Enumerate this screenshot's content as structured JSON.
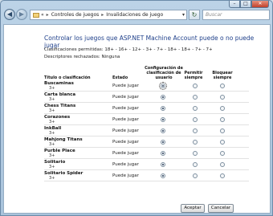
{
  "window": {
    "controls": {
      "minimize": "–",
      "maximize": "□",
      "close": "✕"
    }
  },
  "toolbar": {
    "back_glyph": "◀",
    "forward_glyph": "▶",
    "breadcrumb": [
      "Controles de juegos",
      "Invalidaciones de juego"
    ],
    "breadcrumb_prefix": "«",
    "separator": "▸",
    "refresh_glyph": "↻",
    "search_placeholder": "Buscar"
  },
  "main": {
    "title": "Controlar los juegos que ASP.NET Machine Account puede o no puede jugar",
    "allowed_ratings_label": "Clasificaciones permitidas:",
    "allowed_ratings_value": "18+ - 16+ - 12+ - 3+ - 7+ - 18+ - 18+ - 7+ - 7+",
    "blocked_descriptors_label": "Descriptores rechazados:",
    "blocked_descriptors_value": "Ninguna"
  },
  "table": {
    "headers": {
      "title": "Título o clasificación",
      "state": "Estado",
      "config": "Configuración de clasificación de usuario",
      "allow": "Permitir siempre",
      "block": "Bloquear siempre"
    },
    "rows": [
      {
        "name": "Buscaminas",
        "rating": "3+",
        "state": "Puede jugar",
        "selected": 0
      },
      {
        "name": "Carta blanca",
        "rating": "3+",
        "state": "Puede jugar",
        "selected": 0
      },
      {
        "name": "Chess Titans",
        "rating": "3+",
        "state": "Puede jugar",
        "selected": 0
      },
      {
        "name": "Corazones",
        "rating": "3+",
        "state": "Puede jugar",
        "selected": 0
      },
      {
        "name": "InkBall",
        "rating": "3+",
        "state": "Puede jugar",
        "selected": 0
      },
      {
        "name": "Mahjong Titans",
        "rating": "3+",
        "state": "Puede jugar",
        "selected": 0
      },
      {
        "name": "Purble Place",
        "rating": "3+",
        "state": "Puede jugar",
        "selected": 0
      },
      {
        "name": "Solitario",
        "rating": "3+",
        "state": "Puede jugar",
        "selected": 0
      },
      {
        "name": "Solitario Spider",
        "rating": "3+",
        "state": "Puede jugar",
        "selected": 0
      }
    ]
  },
  "footer": {
    "ok_label": "Aceptar",
    "cancel_label": "Cancelar"
  }
}
